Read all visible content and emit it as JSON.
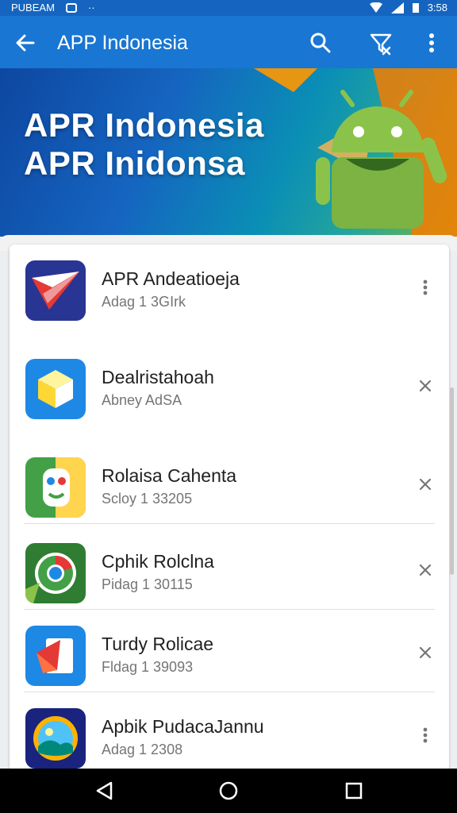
{
  "status_bar": {
    "left_text": "PUBEAM",
    "time": "3:58"
  },
  "app_bar": {
    "title": "APP Indonesia",
    "icons": [
      "arrow-back-icon",
      "search-icon",
      "filter-icon",
      "more-vert-icon"
    ]
  },
  "banner": {
    "line1": "APR Indonesia",
    "line2": "APR Inidonsa",
    "colors": {
      "start": "#0d47a1",
      "end": "#7cb342",
      "android_green": "#8bc34a",
      "accent_orange": "#ff9800"
    }
  },
  "apps": [
    {
      "name": "APR Andeatioeja",
      "subtitle": "Adag 1 3GIrk",
      "action": "more-vert-icon",
      "icon": "red-plane-app-icon"
    },
    {
      "name": "Dealristahoah",
      "subtitle": "Abney AdSA",
      "action": "close-icon",
      "icon": "yellow-cube-app-icon"
    },
    {
      "name": "Rolaisa Cahenta",
      "subtitle": "Scloy 1 33205",
      "action": "close-icon",
      "icon": "face-app-icon"
    },
    {
      "name": "Cphik Rolclna",
      "subtitle": "Pidag 1 30115",
      "action": "close-icon",
      "icon": "chrome-like-app-icon"
    },
    {
      "name": "Turdy Rolicae",
      "subtitle": "Fldag 1 39093",
      "action": "close-icon",
      "icon": "document-app-icon"
    },
    {
      "name": "Apbik PudacaJannu",
      "subtitle": "Adag 1 2308",
      "action": "more-vert-icon",
      "icon": "sun-landscape-app-icon"
    }
  ],
  "nav_bar": {
    "buttons": [
      "back-triangle-icon",
      "home-circle-icon",
      "recents-square-icon"
    ]
  }
}
